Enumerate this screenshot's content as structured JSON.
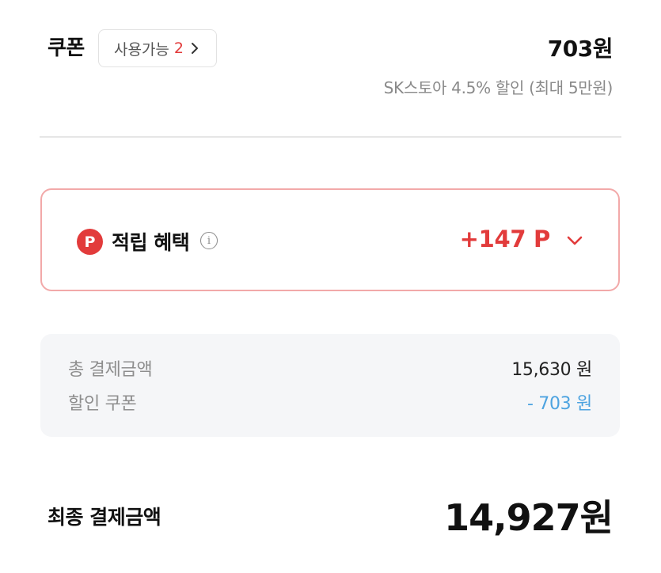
{
  "coupon": {
    "label": "쿠폰",
    "available_label": "사용가능",
    "available_count": "2",
    "amount": "703원",
    "description": "SK스토아 4.5% 할인 (최대 5만원)"
  },
  "points": {
    "icon_letter": "P",
    "title": "적립 혜택",
    "value": "+147 P",
    "accent_color": "#e23b3b",
    "border_color": "#f2a9a9"
  },
  "summary": {
    "total_label": "총 결제금액",
    "total_value": "15,630 원",
    "discount_label": "할인 쿠폰",
    "discount_value": "- 703 원",
    "discount_color": "#4da3e0"
  },
  "final": {
    "label": "최종 결제금액",
    "amount": "14,927원"
  },
  "icons": {
    "chevron_right": "chevron-right-icon",
    "chevron_down": "chevron-down-icon",
    "info": "info-icon",
    "points": "points-p-icon"
  }
}
